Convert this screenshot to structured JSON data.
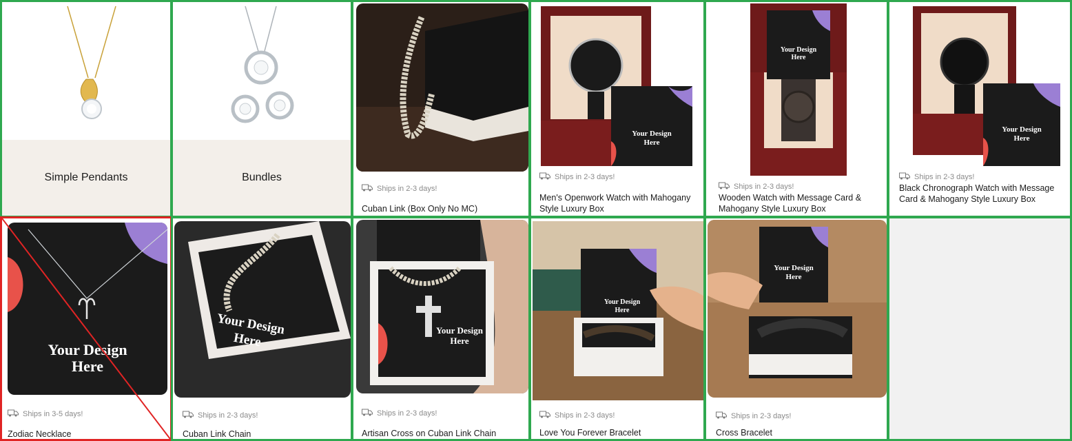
{
  "categories": [
    {
      "label": "Simple Pendants"
    },
    {
      "label": "Bundles"
    }
  ],
  "products": [
    {
      "title": "Cuban Link (Box Only No MC)",
      "shipping": "Ships in 2-3 days!"
    },
    {
      "title": "Men's Openwork Watch with Mahogany Style Luxury Box",
      "shipping": "Ships in 2-3 days!"
    },
    {
      "title": "Wooden Watch with Message Card & Mahogany Style Luxury Box",
      "shipping": "Ships in 2-3 days!"
    },
    {
      "title": "Black Chronograph Watch with Message Card & Mahogany Style Luxury Box",
      "shipping": "Ships in 2-3 days!"
    },
    {
      "title": "Zodiac Necklace",
      "shipping": "Ships in 3-5 days!"
    },
    {
      "title": "Cuban Link Chain",
      "shipping": "Ships in 2-3 days!"
    },
    {
      "title": "Artisan Cross on Cuban Link Chain",
      "shipping": "Ships in 2-3 days!"
    },
    {
      "title": "Love You Forever Bracelet",
      "shipping": "Ships in 2-3 days!"
    },
    {
      "title": "Cross Bracelet",
      "shipping": "Ships in 2-3 days!"
    }
  ],
  "card_text": {
    "line1": "Your Design",
    "line2": "Here"
  },
  "colors": {
    "grid_border": "#2fa84f",
    "selected_border": "#e02424",
    "card_purple": "#9b7fd4",
    "card_red": "#e8524a"
  }
}
